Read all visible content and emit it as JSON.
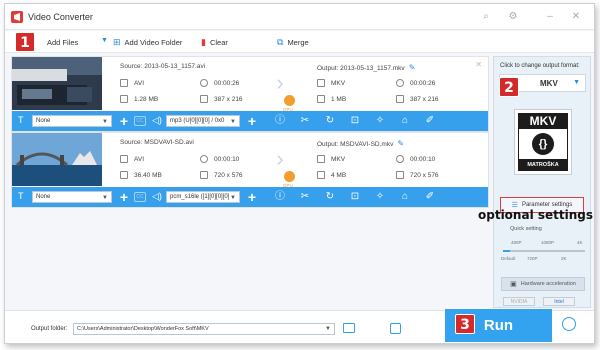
{
  "app": {
    "title": "Video Converter"
  },
  "toolbar": {
    "add_files": "Add Files",
    "add_video_folder": "Add Video Folder",
    "clear": "Clear",
    "merge": "Merge"
  },
  "items": [
    {
      "source": "Source: 2013-05-13_1157.avi",
      "output": "Output: 2013-05-13_1157.mkv",
      "src_format": "AVI",
      "src_duration": "00:00:26",
      "src_size": "1.28 MB",
      "src_resolution": "387 x 216",
      "out_format": "MKV",
      "out_duration": "00:00:26",
      "out_size": "1 MB",
      "out_resolution": "387 x 216",
      "subtitle": "None",
      "audio": "mp3 (U[0][0][0] / 0x0"
    },
    {
      "source": "Source: MSDVAVI-SD.avi",
      "output": "Output: MSDVAVI-SD.mkv",
      "src_format": "AVI",
      "src_duration": "00:00:10",
      "src_size": "36.40 MB",
      "src_resolution": "720 x 576",
      "out_format": "MKV",
      "out_duration": "00:00:10",
      "out_size": "4 MB",
      "out_resolution": "720 x 576",
      "subtitle": "None",
      "audio": "pcm_s16le ([1][0][0][0]"
    }
  ],
  "gpu_label": "GPU",
  "right_panel": {
    "hint": "Click to change output format:",
    "format": "MKV",
    "logo_head": "MKV",
    "logo_brace": "{}",
    "logo_foot": "MATROŠKA",
    "parameter_settings": "Parameter settings",
    "quick_setting": "Quick setting",
    "ticks_top": [
      "480P",
      "1080P",
      "4K"
    ],
    "ticks_bottom": [
      "Default",
      "720P",
      "2K"
    ],
    "quality_position": 0.08,
    "hardware_acceleration": "Hardware acceleration",
    "chips": [
      "NVIDIA",
      "Intel"
    ]
  },
  "annotation": {
    "optional_settings": "optional settings",
    "badge1": "1",
    "badge2": "2",
    "badge3": "3"
  },
  "bottom": {
    "output_folder_label": "Output folder:",
    "output_folder_value": "C:\\Users\\Administrator\\Desktop\\WonderFox Soft\\MKV",
    "run": "Run"
  },
  "colors": {
    "accent": "#37a0ec",
    "badge": "#d42a2a",
    "gpu": "#f29d2f"
  }
}
